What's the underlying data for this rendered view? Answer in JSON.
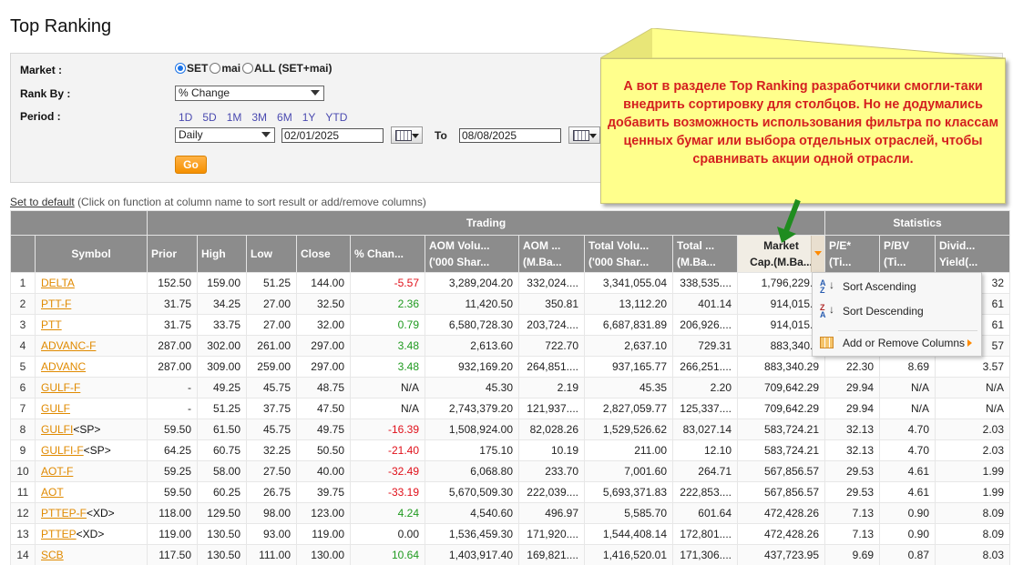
{
  "page": {
    "title": "Top Ranking"
  },
  "filters": {
    "market_label": "Market :",
    "market_options": [
      {
        "label": "SET",
        "selected": true
      },
      {
        "label": "mai",
        "selected": false
      },
      {
        "label": "ALL (SET+mai)",
        "selected": false
      }
    ],
    "rank_by_label": "Rank By :",
    "rank_by_value": "% Change",
    "period_label": "Period :",
    "period_links": [
      "1D",
      "5D",
      "1M",
      "3M",
      "6M",
      "1Y",
      "YTD"
    ],
    "period_type": "Daily",
    "date_from": "02/01/2025",
    "to_label": "To",
    "date_to": "08/08/2025",
    "go_label": "Go"
  },
  "set_default": {
    "link": "Set to default",
    "hint": "(Click on function at column name to sort result or add/remove columns)"
  },
  "table": {
    "groups": {
      "trading": "Trading",
      "statistics": "Statistics"
    },
    "columns": {
      "symbol": "Symbol",
      "prior": "Prior",
      "high": "High",
      "low": "Low",
      "close": "Close",
      "pct_change": "% Chan...",
      "aom_vol_1": "AOM Volu...",
      "aom_vol_2": "('000 Shar...",
      "aom_val_1": "AOM ...",
      "aom_val_2": "(M.Ba...",
      "total_vol_1": "Total Volu...",
      "total_vol_2": "('000 Shar...",
      "total_val_1": "Total ...",
      "total_val_2": "(M.Ba...",
      "mcap_1": "Market",
      "mcap_2": "Cap.(M.Ba...",
      "pe_1": "P/E*",
      "pe_2": "(Ti...",
      "pbv_1": "P/BV",
      "pbv_2": "(Ti...",
      "div_1": "Divid...",
      "div_2": "Yield(..."
    },
    "rows": [
      {
        "n": "1",
        "symbol": "DELTA",
        "suffix": "",
        "prior": "152.50",
        "high": "159.00",
        "low": "51.25",
        "close": "144.00",
        "chg": "-5.57",
        "dir": "neg",
        "aom_vol": "3,289,204.20",
        "aom_val": "332,024....",
        "tot_vol": "3,341,055.04",
        "tot_val": "338,535....",
        "mcap": "1,796,229.9",
        "pe": "",
        "pbv": "",
        "div": "32"
      },
      {
        "n": "2",
        "symbol": "PTT-F",
        "suffix": "",
        "prior": "31.75",
        "high": "34.25",
        "low": "27.00",
        "close": "32.50",
        "chg": "2.36",
        "dir": "pos",
        "aom_vol": "11,420.50",
        "aom_val": "350.81",
        "tot_vol": "13,112.20",
        "tot_val": "401.14",
        "mcap": "914,015.8",
        "pe": "",
        "pbv": "",
        "div": "61"
      },
      {
        "n": "3",
        "symbol": "PTT",
        "suffix": "",
        "prior": "31.75",
        "high": "33.75",
        "low": "27.00",
        "close": "32.00",
        "chg": "0.79",
        "dir": "pos",
        "aom_vol": "6,580,728.30",
        "aom_val": "203,724....",
        "tot_vol": "6,687,831.89",
        "tot_val": "206,926....",
        "mcap": "914,015.8",
        "pe": "",
        "pbv": "",
        "div": "61"
      },
      {
        "n": "4",
        "symbol": "ADVANC-F",
        "suffix": "",
        "prior": "287.00",
        "high": "302.00",
        "low": "261.00",
        "close": "297.00",
        "chg": "3.48",
        "dir": "pos",
        "aom_vol": "2,613.60",
        "aom_val": "722.70",
        "tot_vol": "2,637.10",
        "tot_val": "729.31",
        "mcap": "883,340.2",
        "pe": "",
        "pbv": "",
        "div": "57"
      },
      {
        "n": "5",
        "symbol": "ADVANC",
        "suffix": "",
        "prior": "287.00",
        "high": "309.00",
        "low": "259.00",
        "close": "297.00",
        "chg": "3.48",
        "dir": "pos",
        "aom_vol": "932,169.20",
        "aom_val": "264,851....",
        "tot_vol": "937,165.77",
        "tot_val": "266,251....",
        "mcap": "883,340.29",
        "pe": "22.30",
        "pbv": "8.69",
        "div": "3.57"
      },
      {
        "n": "6",
        "symbol": "GULF-F",
        "suffix": "",
        "prior": "-",
        "high": "49.25",
        "low": "45.75",
        "close": "48.75",
        "chg": "N/A",
        "dir": "",
        "aom_vol": "45.30",
        "aom_val": "2.19",
        "tot_vol": "45.35",
        "tot_val": "2.20",
        "mcap": "709,642.29",
        "pe": "29.94",
        "pbv": "N/A",
        "div": "N/A"
      },
      {
        "n": "7",
        "symbol": "GULF",
        "suffix": "",
        "prior": "-",
        "high": "51.25",
        "low": "37.75",
        "close": "47.50",
        "chg": "N/A",
        "dir": "",
        "aom_vol": "2,743,379.20",
        "aom_val": "121,937....",
        "tot_vol": "2,827,059.77",
        "tot_val": "125,337....",
        "mcap": "709,642.29",
        "pe": "29.94",
        "pbv": "N/A",
        "div": "N/A"
      },
      {
        "n": "8",
        "symbol": "GULFI",
        "suffix": "<SP>",
        "prior": "59.50",
        "high": "61.50",
        "low": "45.75",
        "close": "49.75",
        "chg": "-16.39",
        "dir": "neg",
        "aom_vol": "1,508,924.00",
        "aom_val": "82,028.26",
        "tot_vol": "1,529,526.62",
        "tot_val": "83,027.14",
        "mcap": "583,724.21",
        "pe": "32.13",
        "pbv": "4.70",
        "div": "2.03"
      },
      {
        "n": "9",
        "symbol": "GULFI-F",
        "suffix": "<SP>",
        "prior": "64.25",
        "high": "60.75",
        "low": "32.25",
        "close": "50.50",
        "chg": "-21.40",
        "dir": "neg",
        "aom_vol": "175.10",
        "aom_val": "10.19",
        "tot_vol": "211.00",
        "tot_val": "12.10",
        "mcap": "583,724.21",
        "pe": "32.13",
        "pbv": "4.70",
        "div": "2.03"
      },
      {
        "n": "10",
        "symbol": "AOT-F",
        "suffix": "",
        "prior": "59.25",
        "high": "58.00",
        "low": "27.50",
        "close": "40.00",
        "chg": "-32.49",
        "dir": "neg",
        "aom_vol": "6,068.80",
        "aom_val": "233.70",
        "tot_vol": "7,001.60",
        "tot_val": "264.71",
        "mcap": "567,856.57",
        "pe": "29.53",
        "pbv": "4.61",
        "div": "1.99"
      },
      {
        "n": "11",
        "symbol": "AOT",
        "suffix": "",
        "prior": "59.50",
        "high": "60.25",
        "low": "26.75",
        "close": "39.75",
        "chg": "-33.19",
        "dir": "neg",
        "aom_vol": "5,670,509.30",
        "aom_val": "222,039....",
        "tot_vol": "5,693,371.83",
        "tot_val": "222,853....",
        "mcap": "567,856.57",
        "pe": "29.53",
        "pbv": "4.61",
        "div": "1.99"
      },
      {
        "n": "12",
        "symbol": "PTTEP-F",
        "suffix": "<XD>",
        "prior": "118.00",
        "high": "129.50",
        "low": "98.00",
        "close": "123.00",
        "chg": "4.24",
        "dir": "pos",
        "aom_vol": "4,540.60",
        "aom_val": "496.97",
        "tot_vol": "5,585.70",
        "tot_val": "601.64",
        "mcap": "472,428.26",
        "pe": "7.13",
        "pbv": "0.90",
        "div": "8.09"
      },
      {
        "n": "13",
        "symbol": "PTTEP",
        "suffix": "<XD>",
        "prior": "119.00",
        "high": "130.50",
        "low": "93.00",
        "close": "119.00",
        "chg": "0.00",
        "dir": "",
        "aom_vol": "1,536,459.30",
        "aom_val": "171,920....",
        "tot_vol": "1,544,408.14",
        "tot_val": "172,801....",
        "mcap": "472,428.26",
        "pe": "7.13",
        "pbv": "0.90",
        "div": "8.09"
      },
      {
        "n": "14",
        "symbol": "SCB",
        "suffix": "",
        "prior": "117.50",
        "high": "130.50",
        "low": "111.00",
        "close": "130.00",
        "chg": "10.64",
        "dir": "pos",
        "aom_vol": "1,403,917.40",
        "aom_val": "169,821....",
        "tot_vol": "1,416,520.01",
        "tot_val": "171,306....",
        "mcap": "437,723.95",
        "pe": "9.69",
        "pbv": "0.87",
        "div": "8.03"
      }
    ]
  },
  "column_menu": {
    "sort_asc": "Sort Ascending",
    "sort_desc": "Sort Descending",
    "add_remove": "Add or Remove Columns"
  },
  "callout": {
    "text": "А вот в разделе Top Ranking разработчики смогли-таки внедрить сортировку для столбцов. Но не додумались добавить возможность использования фильтра по классам ценных бумаг или выбора отдельных отраслей, чтобы сравнивать акции одной отрасли.",
    "bg_color": "#ffff8c",
    "text_color": "#d41f1f",
    "arrow_color": "#1f8c1f"
  }
}
